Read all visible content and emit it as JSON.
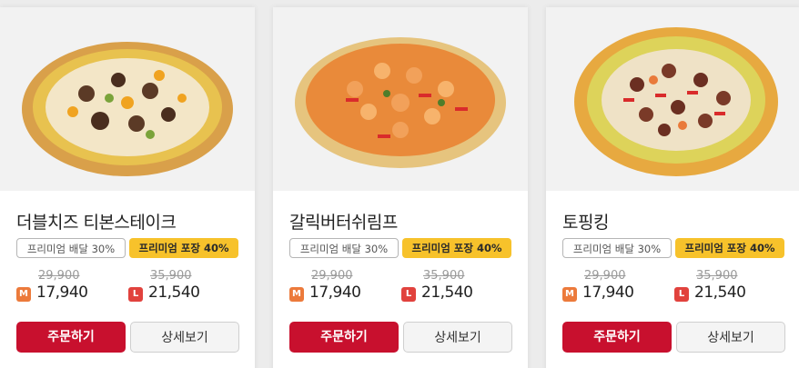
{
  "colors": {
    "accent_red": "#c8102e",
    "pickup_yellow": "#f7c22b",
    "size_m": "#ec7a3b",
    "size_l": "#e1423d"
  },
  "products": [
    {
      "name": "더블치즈 티본스테이크",
      "badges": {
        "delivery": "프리미엄 배달 30%",
        "pickup": "프리미엄 포장 40%"
      },
      "price_m": {
        "size": "M",
        "original": "29,900",
        "sale": "17,940"
      },
      "price_l": {
        "size": "L",
        "original": "35,900",
        "sale": "21,540"
      },
      "order_label": "주문하기",
      "detail_label": "상세보기"
    },
    {
      "name": "갈릭버터쉬림프",
      "badges": {
        "delivery": "프리미엄 배달 30%",
        "pickup": "프리미엄 포장 40%"
      },
      "price_m": {
        "size": "M",
        "original": "29,900",
        "sale": "17,940"
      },
      "price_l": {
        "size": "L",
        "original": "35,900",
        "sale": "21,540"
      },
      "order_label": "주문하기",
      "detail_label": "상세보기"
    },
    {
      "name": "토핑킹",
      "badges": {
        "delivery": "프리미엄 배달 30%",
        "pickup": "프리미엄 포장 40%"
      },
      "price_m": {
        "size": "M",
        "original": "29,900",
        "sale": "17,940"
      },
      "price_l": {
        "size": "L",
        "original": "35,900",
        "sale": "21,540"
      },
      "order_label": "주문하기",
      "detail_label": "상세보기"
    }
  ]
}
